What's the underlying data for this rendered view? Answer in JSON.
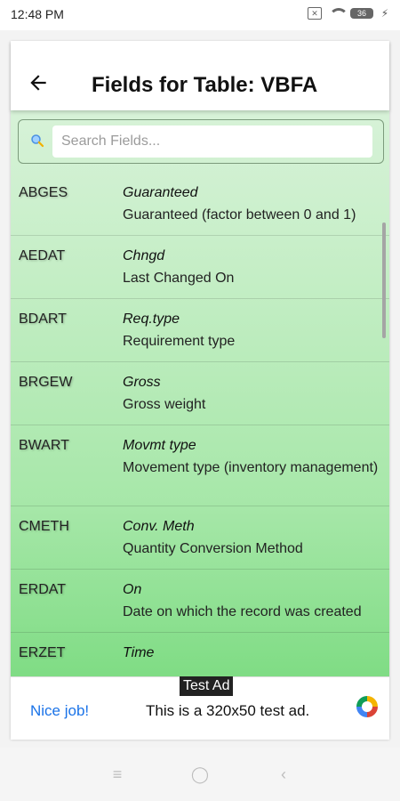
{
  "status_bar": {
    "time": "12:48 PM",
    "battery_level": "36"
  },
  "header": {
    "title": "Fields for Table: VBFA"
  },
  "search": {
    "placeholder": "Search Fields..."
  },
  "fields": [
    {
      "code": "ABGES",
      "short": "Guaranteed",
      "description": "Guaranteed (factor between 0 and 1)"
    },
    {
      "code": "AEDAT",
      "short": "Chngd",
      "description": "Last Changed On"
    },
    {
      "code": "BDART",
      "short": "Req.type",
      "description": "Requirement type"
    },
    {
      "code": "BRGEW",
      "short": "Gross",
      "description": "Gross weight"
    },
    {
      "code": "BWART",
      "short": "Movmt type",
      "description": "Movement type (inventory management)"
    },
    {
      "code": "CMETH",
      "short": "Conv. Meth",
      "description": "Quantity Conversion Method"
    },
    {
      "code": "ERDAT",
      "short": "On",
      "description": "Date on which the record was created"
    },
    {
      "code": "ERZET",
      "short": "Time",
      "description": ""
    }
  ],
  "ad": {
    "label": "Test Ad",
    "cta": "Nice job!",
    "text": "This is a 320x50 test ad."
  },
  "colors": {
    "list_gradient_top": "#d7f2d8",
    "list_gradient_bottom": "#7fdc84",
    "ad_cta": "#1a73e8"
  }
}
